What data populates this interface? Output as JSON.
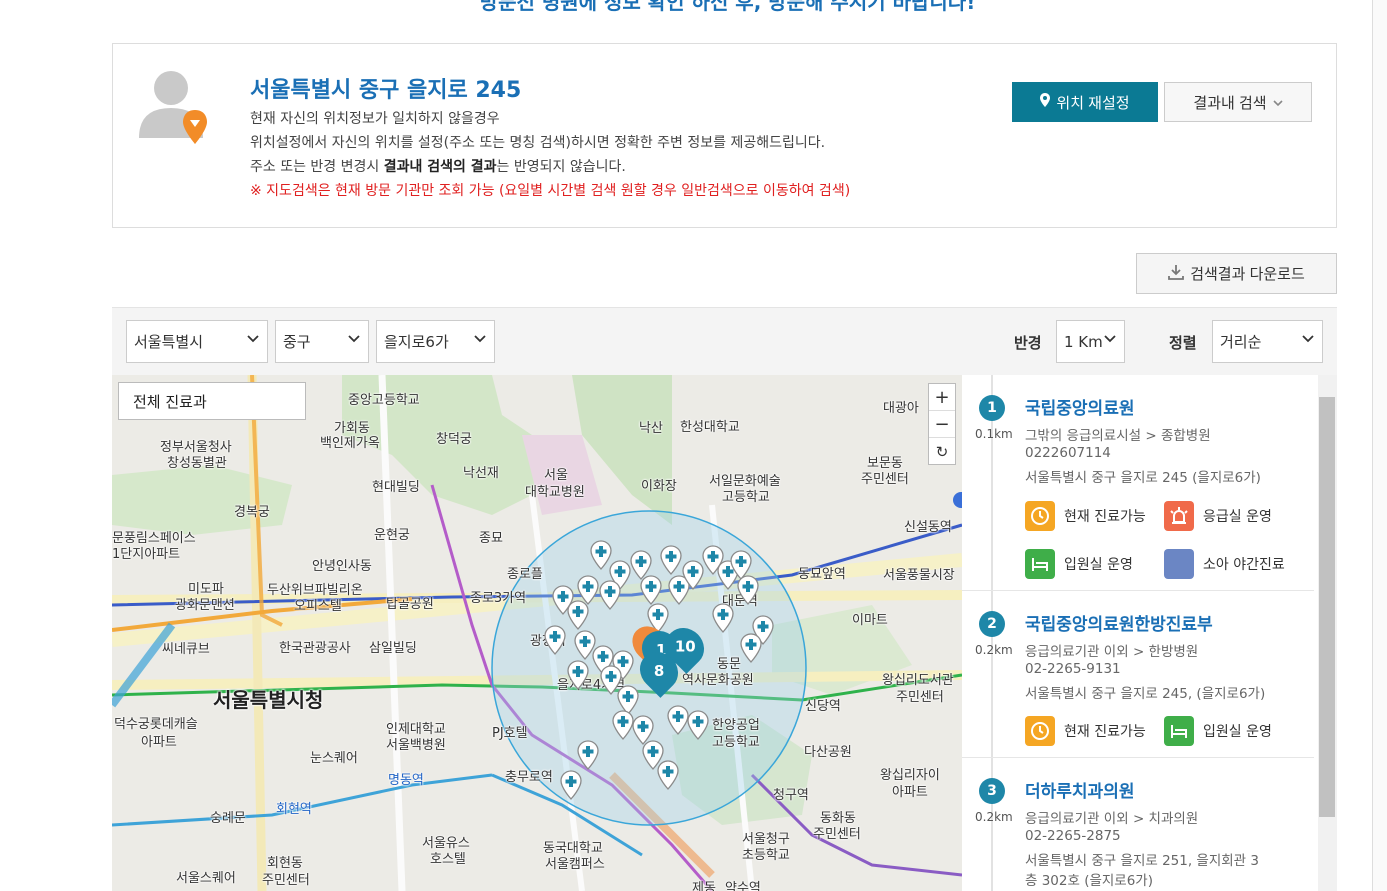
{
  "banner": {
    "text": "방문전 병원에 정보 확인 하신 후, 방문해 주시기 바랍니다!"
  },
  "location": {
    "address": "서울특별시 중구 을지로 245",
    "line1": "현재 자신의 위치정보가 일치하지 않을경우",
    "line2": "위치설정에서 자신의 위치를 설정(주소 또는 명칭 검색)하시면 정확한 주변 정보를 제공해드립니다.",
    "line3_pre": "주소 또는 반경 변경시 ",
    "line3_bold": "결과내 검색의 결과",
    "line3_post": "는 반영되지 않습니다.",
    "warning": "※ 지도검색은 현재 방문 기관만 조회 가능 (요일별 시간별 검색 원할 경우 일반검색으로 이동하여 검색)",
    "reset_button": "위치 재설정",
    "insearch_button": "결과내 검색"
  },
  "download_button": "검색결과 다운로드",
  "filters": {
    "city": "서울특별시",
    "district": "중구",
    "dong": "을지로6가",
    "radius_label": "반경",
    "radius": "1 Km",
    "sort_label": "정렬",
    "sort": "거리순"
  },
  "map": {
    "dept_button": "전체 진료과",
    "zoom_in": "+",
    "zoom_out": "−",
    "refresh": "↻",
    "cluster_1": "1",
    "cluster_8": "8",
    "cluster_10": "10",
    "labels": {
      "l1": "중앙고등학교",
      "l2": "가회동",
      "l3": "백인제가옥",
      "l4": "창덕궁",
      "l5": "정부서울청사",
      "l6": "창성동별관",
      "l7": "낙산",
      "l8": "한성대학교",
      "l9": "낙선재",
      "l10": "서울",
      "l11": "대학교병원",
      "l12": "이화장",
      "l13": "서일문화예술",
      "l14": "고등학교",
      "l15": "보문동",
      "l16": "주민센터",
      "l17": "대광아",
      "l18": "현대빌딩",
      "l19": "경복궁",
      "l20": "운현궁",
      "l21": "종묘",
      "l22": "문풍림스페이스",
      "l23": "1단지아파트",
      "l24": "안녕인사동",
      "l25": "신설동역",
      "l26": "미도파",
      "l27": "광화문맨션",
      "l28": "두산위브파빌리온",
      "l29": "오피스텔",
      "l30": "탑골공원",
      "l31": "종로3가역",
      "l32": "종로플",
      "l33": "동묘앞역",
      "l34": "서울풍물시장",
      "l35": "이마트",
      "l36": "씨네큐브",
      "l37": "한국관광공사",
      "l38": "삼일빌딩",
      "l39": "광장시",
      "l40": "대문역",
      "l41": "동문",
      "l42": "역사문화공원",
      "l43": "서울특별시청",
      "l44": "을지로4가역",
      "l45": "왕십리도서관",
      "l46": "주민센터",
      "l47": "신당역",
      "l48": "덕수궁롯데캐슬",
      "l49": "아파트",
      "l50": "인제대학교",
      "l51": "서울백병원",
      "l52": "PJ호텔",
      "l53": "한양공업",
      "l54": "고등학교",
      "l55": "눈스퀘어",
      "l56": "다산공원",
      "l57": "충무로역",
      "l58": "명동역",
      "l59": "청구역",
      "l60": "왕십리자이",
      "l61": "아파트",
      "l62": "숭례문",
      "l63": "회현역",
      "l64": "동화동",
      "l65": "주민센터",
      "l66": "서울유스",
      "l67": "호스텔",
      "l68": "동국대학교",
      "l69": "서울캠퍼스",
      "l70": "서울청구",
      "l71": "초등학교",
      "l72": "회현동",
      "l73": "주민센터",
      "l74": "서울스퀘어",
      "l75": "약수역",
      "l76": "제동"
    }
  },
  "results": [
    {
      "num": "1",
      "dist": "0.1km",
      "name": "국립중앙의료원",
      "category": "그밖의 응급의료시설 > 종합병원",
      "phone": "0222607114",
      "addr1": "서울특별시 중구 을지로 245 (을지로6가)",
      "addr2": "",
      "badges": [
        {
          "label": "현재 진료가능",
          "icon": "clock-icon",
          "color": "#f5a623"
        },
        {
          "label": "응급실 운영",
          "icon": "siren-icon",
          "color": "#f06a4a"
        },
        {
          "label": "입원실 운영",
          "icon": "bed-icon",
          "color": "#3fae49"
        },
        {
          "label": "소아 야간진료",
          "icon": "moon-icon",
          "color": "#6b86c4"
        }
      ]
    },
    {
      "num": "2",
      "dist": "0.2km",
      "name": "국립중앙의료원한방진료부",
      "category": "응급의료기관 이외 > 한방병원",
      "phone": "02-2265-9131",
      "addr1": "서울특별시 중구 을지로 245, (을지로6가)",
      "addr2": "",
      "badges": [
        {
          "label": "현재 진료가능",
          "icon": "clock-icon",
          "color": "#f5a623"
        },
        {
          "label": "입원실 운영",
          "icon": "bed-icon",
          "color": "#3fae49"
        }
      ]
    },
    {
      "num": "3",
      "dist": "0.2km",
      "name": "더하루치과의원",
      "category": "응급의료기관 이외 > 치과의원",
      "phone": "02-2265-2875",
      "addr1": "서울특별시 중구 을지로 251, 을지회관 3",
      "addr2": "층 302호 (을지로6가)",
      "badges": []
    }
  ]
}
